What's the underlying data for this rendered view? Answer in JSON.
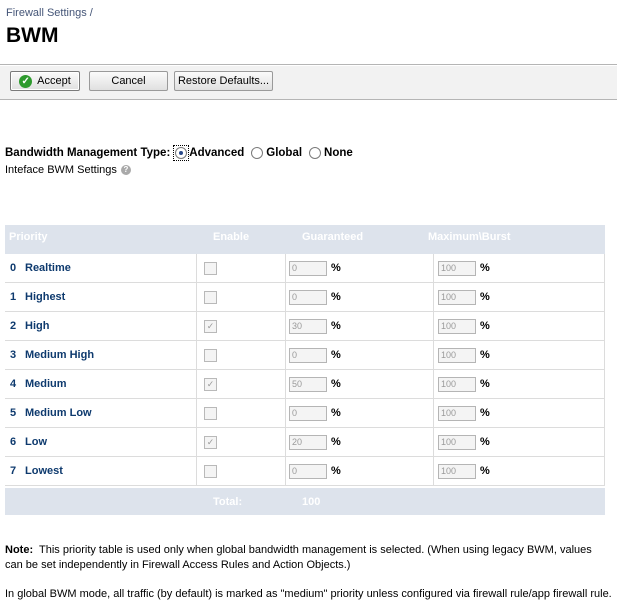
{
  "breadcrumb": "Firewall Settings /",
  "title": "BWM",
  "toolbar": {
    "accept_label": "Accept",
    "cancel_label": "Cancel",
    "restore_label": "Restore Defaults..."
  },
  "bwm_type": {
    "label": "Bandwidth Management Type:",
    "options": [
      {
        "label": "Advanced",
        "selected": true
      },
      {
        "label": "Global",
        "selected": false
      },
      {
        "label": "None",
        "selected": false
      }
    ]
  },
  "interface_settings_label": "Inteface BWM Settings",
  "table": {
    "headers": {
      "priority": "Priority",
      "enable": "Enable",
      "guaranteed": "Guaranteed",
      "maximum": "Maximum\\Burst"
    },
    "rows": [
      {
        "num": "0",
        "name": "Realtime",
        "enabled": false,
        "guaranteed": "0",
        "maximum": "100",
        "pct": "%"
      },
      {
        "num": "1",
        "name": "Highest",
        "enabled": false,
        "guaranteed": "0",
        "maximum": "100",
        "pct": "%"
      },
      {
        "num": "2",
        "name": "High",
        "enabled": true,
        "guaranteed": "30",
        "maximum": "100",
        "pct": "%"
      },
      {
        "num": "3",
        "name": "Medium High",
        "enabled": false,
        "guaranteed": "0",
        "maximum": "100",
        "pct": "%"
      },
      {
        "num": "4",
        "name": "Medium",
        "enabled": true,
        "guaranteed": "50",
        "maximum": "100",
        "pct": "%"
      },
      {
        "num": "5",
        "name": "Medium Low",
        "enabled": false,
        "guaranteed": "0",
        "maximum": "100",
        "pct": "%"
      },
      {
        "num": "6",
        "name": "Low",
        "enabled": true,
        "guaranteed": "20",
        "maximum": "100",
        "pct": "%"
      },
      {
        "num": "7",
        "name": "Lowest",
        "enabled": false,
        "guaranteed": "0",
        "maximum": "100",
        "pct": "%"
      }
    ],
    "total_label": "Total:",
    "total_value": "100"
  },
  "note": {
    "label": "Note:",
    "text": "This priority table is used only when global bandwidth management is selected. (When using legacy BWM, values can be set independently in Firewall Access Rules and Action Objects.)",
    "text2": "In global BWM mode, all traffic (by default) is marked as \"medium\" priority unless configured via firewall rule/app firewall rule."
  },
  "colors": {
    "header_bg": "#dde3ec",
    "priority_text": "#0e3a6e",
    "accept_icon": "#2e9a2e"
  },
  "icons": {
    "accept": "check-circle-icon",
    "help": "help-icon"
  }
}
